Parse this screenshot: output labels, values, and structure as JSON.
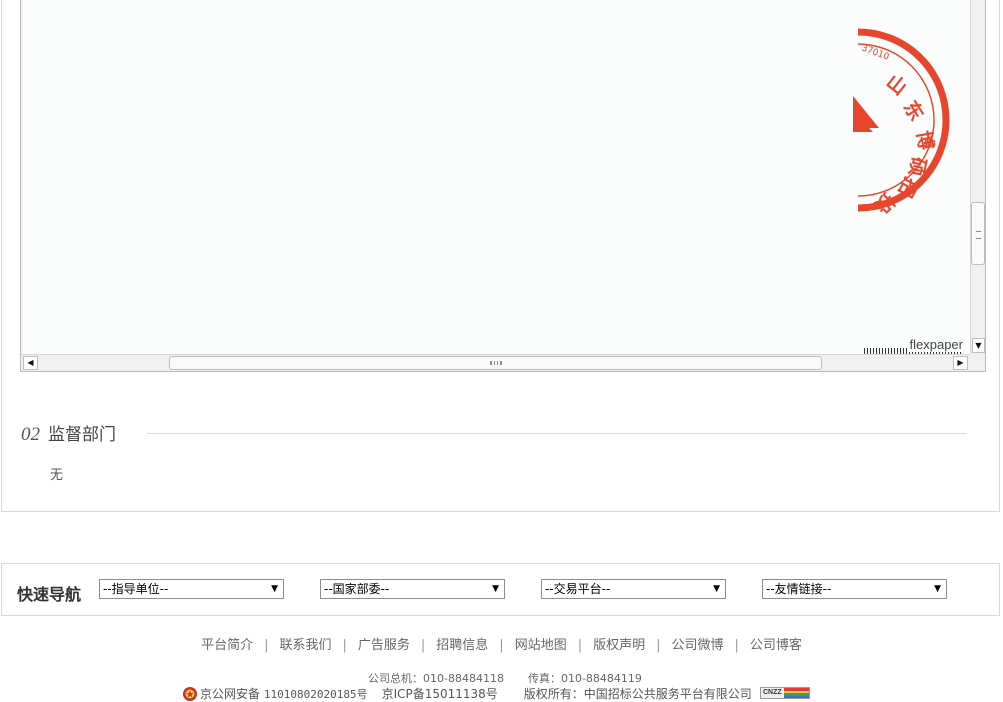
{
  "viewer": {
    "brand": "flexpaper",
    "seal_text": "山东博硕招投标有限公司",
    "seal_number": "37010"
  },
  "section": {
    "number": "02",
    "title": "监督部门",
    "content": "无"
  },
  "quick_nav": {
    "label": "快速导航",
    "selects": [
      {
        "value": "--指导单位--"
      },
      {
        "value": "--国家部委--"
      },
      {
        "value": "--交易平台--"
      },
      {
        "value": "--友情链接--"
      }
    ]
  },
  "footer": {
    "links": [
      "平台简介",
      "联系我们",
      "广告服务",
      "招聘信息",
      "网站地图",
      "版权声明",
      "公司微博",
      "公司博客"
    ],
    "separator": "|",
    "hotline": "公司总机：010-88484118",
    "fax": "传真：010-88484119",
    "police_record": "京公网安备",
    "police_number": "11010802020185号",
    "icp": "京ICP备15011138号",
    "copyright": "版权所有：中国招标公共服务平台有限公司",
    "badge": "CNZZ"
  },
  "colors": {
    "seal_red": "#e8452d",
    "border": "#d9d9d9"
  }
}
